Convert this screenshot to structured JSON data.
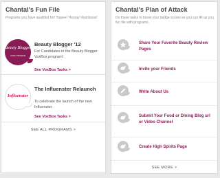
{
  "fun_file": {
    "title": "Chantal's Fun File",
    "subtitle": "Programs you have qualified for! Yippee! Hooray! Rainbows!",
    "programs": [
      {
        "badge_text": "Beauty Blogger",
        "badge_subtext": "VoxBox PROGRAM",
        "title": "Beauty Blogger '12",
        "description": "For Candidates in the Beauty Blogger VoxBox program!",
        "link": "See VoxBox Tasks >"
      },
      {
        "badge_text": "Influenster",
        "badge_subtext": "",
        "title": "The Influenster Relaunch",
        "description": "To celebrate the launch of the new Influenster",
        "link": "See VoxBox Tasks >"
      }
    ],
    "see_all": "SEE ALL PROGRAMS >"
  },
  "plan_of_attack": {
    "title": "Chantal's Plan of Attack",
    "subtitle": "Do these tasks to boost your badge scores so you can fill up you fun file with programs.",
    "tasks": [
      {
        "label": "Share Your Favorite Beauty Review Pages",
        "icon": "star-icon"
      },
      {
        "label": "Invite your Friends",
        "icon": "bird-icon"
      },
      {
        "label": "Write About Us",
        "icon": "pencil-icon"
      },
      {
        "label": "Submit Your Food or Dining Blog url or Video Channel",
        "icon": "link-icon"
      },
      {
        "label": "Create High Spirits Page",
        "icon": "bird-icon"
      }
    ],
    "see_more": "SEE MORE >"
  },
  "colors": {
    "accent": "#8a1c55",
    "icon_gray": "#c9c9c9",
    "background": "#e9e9e9"
  }
}
